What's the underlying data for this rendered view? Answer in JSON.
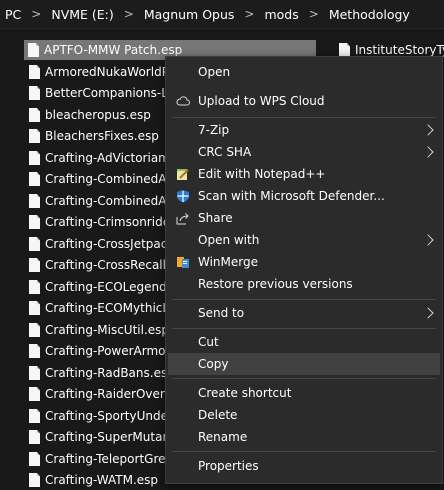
{
  "breadcrumb": {
    "items": [
      "PC",
      "NVME (E:)",
      "Magnum Opus",
      "mods",
      "Methodology"
    ]
  },
  "files": [
    "APTFO-MMW Patch.esp",
    "ArmoredNukaWorldPack",
    "BetterCompanions-Live",
    "bleacheropus.esp",
    "BleachersFixes.esp",
    "Crafting-AdVictoriam.e",
    "Crafting-CombinedArm",
    "Crafting-CombinedArm",
    "Crafting-Crimsonrider",
    "Crafting-CrossJetpack.e",
    "Crafting-CrossRecall.e",
    "Crafting-ECOLegendar",
    "Crafting-ECOMythicLe",
    "Crafting-MiscUtil.esp",
    "Crafting-PowerArmorA",
    "Crafting-RadBans.esp",
    "Crafting-RaiderOverha",
    "Crafting-SportyUnderw",
    "Crafting-SuperMutant",
    "Crafting-TeleportGrena",
    "Crafting-WATM.esp"
  ],
  "right_column": [
    "InstituteStoryTypo"
  ],
  "menu": {
    "open": "Open",
    "upload_wps": "Upload to WPS Cloud",
    "seven_zip": "7-Zip",
    "crc_sha": "CRC SHA",
    "edit_notepad": "Edit with Notepad++",
    "scan_defender": "Scan with Microsoft Defender...",
    "share": "Share",
    "open_with": "Open with",
    "winmerge": "WinMerge",
    "restore": "Restore previous versions",
    "send_to": "Send to",
    "cut": "Cut",
    "copy": "Copy",
    "create_shortcut": "Create shortcut",
    "delete": "Delete",
    "rename": "Rename",
    "properties": "Properties"
  },
  "colors": {
    "background": "#191919",
    "menu_bg": "#2b2b2b",
    "hover": "#414141",
    "selected_row": "#777777"
  }
}
